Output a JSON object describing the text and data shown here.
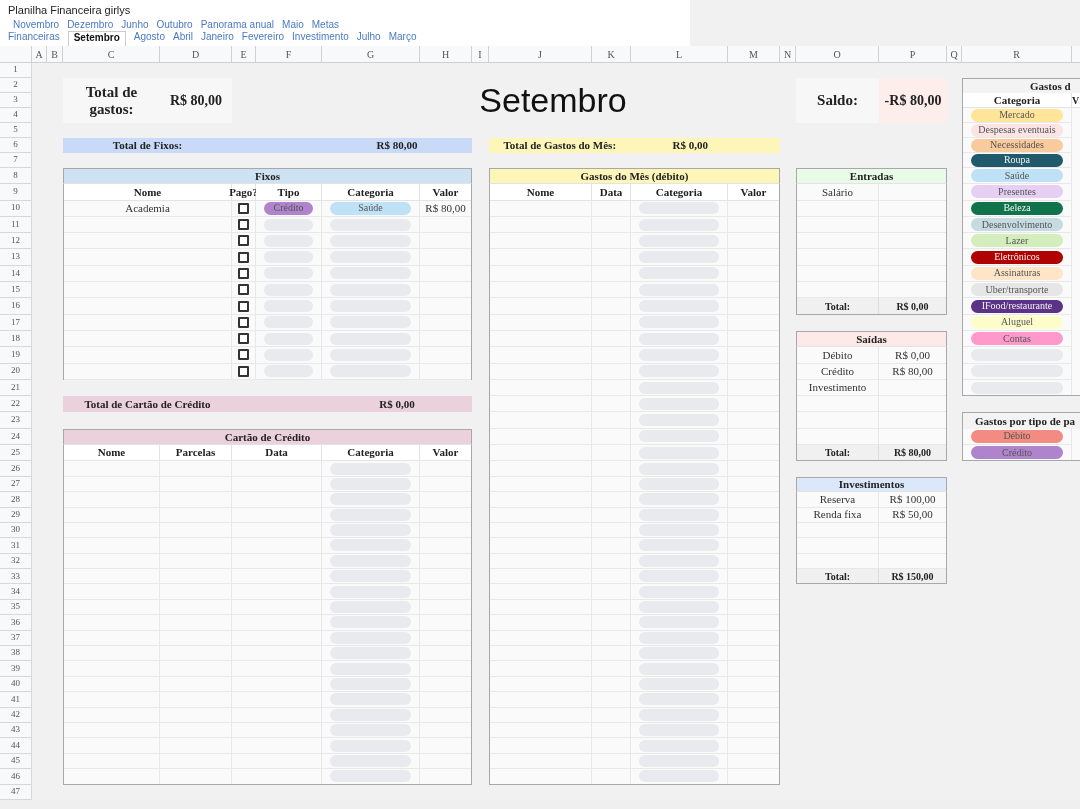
{
  "document_title": "Planilha Financeira girlys",
  "sheet_tabs": [
    [
      {
        "label": "Novembro",
        "selected": false
      },
      {
        "label": "Dezembro",
        "selected": false
      },
      {
        "label": "Junho",
        "selected": false
      },
      {
        "label": "Outubro",
        "selected": false
      },
      {
        "label": "Panorama anual",
        "selected": false
      },
      {
        "label": "Maio",
        "selected": false
      },
      {
        "label": "Metas",
        "selected": false
      }
    ],
    [
      {
        "label": "Financeiras",
        "selected": false
      },
      {
        "label": "Setembro",
        "selected": true
      },
      {
        "label": "Agosto",
        "selected": false
      },
      {
        "label": "Abril",
        "selected": false
      },
      {
        "label": "Janeiro",
        "selected": false
      },
      {
        "label": "Fevereiro",
        "selected": false
      },
      {
        "label": "Investimento",
        "selected": false
      },
      {
        "label": "Julho",
        "selected": false
      },
      {
        "label": "Março",
        "selected": false
      }
    ]
  ],
  "column_headers": [
    "A",
    "B",
    "C",
    "D",
    "E",
    "F",
    "G",
    "H",
    "I",
    "J",
    "K",
    "L",
    "M",
    "N",
    "O",
    "P",
    "Q",
    "R"
  ],
  "row_numbers": [
    "1",
    "2",
    "3",
    "4",
    "5",
    "6",
    "7",
    "8",
    "9",
    "10",
    "11",
    "12",
    "13",
    "14",
    "15",
    "16",
    "17",
    "18",
    "19",
    "20",
    "21",
    "22",
    "23",
    "24",
    "25",
    "26",
    "27",
    "28",
    "29",
    "30",
    "31",
    "32",
    "33",
    "34",
    "35",
    "36",
    "37",
    "38",
    "39",
    "40",
    "41",
    "42",
    "43",
    "44",
    "45",
    "46",
    "47"
  ],
  "summary": {
    "total_label": "Total de gastos:",
    "total_value": "R$ 80,00",
    "month_title": "Setembro",
    "saldo_label": "Saldo:",
    "saldo_value": "-R$ 80,00"
  },
  "fixos_total": {
    "label": "Total de Fixos:",
    "value": "R$ 80,00"
  },
  "fixos": {
    "title": "Fixos",
    "columns": [
      "Nome",
      "Pago?",
      "Tipo",
      "Categoria",
      "Valor"
    ],
    "rows": [
      {
        "nome": "Academia",
        "pago": false,
        "tipo": {
          "label": "Crédito",
          "color": "#b084cc"
        },
        "categoria": {
          "label": "Saúde",
          "color": "#bfe1f6"
        },
        "valor": "R$ 80,00"
      },
      {
        "pago": false
      },
      {
        "pago": false
      },
      {
        "pago": false
      },
      {
        "pago": false
      },
      {
        "pago": false
      },
      {
        "pago": false
      },
      {
        "pago": false
      },
      {
        "pago": false
      },
      {
        "pago": false
      },
      {
        "pago": false
      }
    ]
  },
  "gastos_total": {
    "label": "Total de Gastos do Mês:",
    "value": "R$ 0,00"
  },
  "gastos_mes": {
    "title": "Gastos do Mês (débito)",
    "columns": [
      "Nome",
      "Data",
      "Categoria",
      "Valor"
    ]
  },
  "cartao_total": {
    "label": "Total de Cartão de Crédito",
    "value": "R$ 0,00"
  },
  "cartao": {
    "title": "Cartão de Crédito",
    "columns": [
      "Nome",
      "Parcelas",
      "Data",
      "Categoria",
      "Valor"
    ]
  },
  "entradas": {
    "title": "Entradas",
    "rows": [
      {
        "label": "Salário"
      }
    ],
    "total_label": "Total:",
    "total_value": "R$ 0,00"
  },
  "saidas": {
    "title": "Saídas",
    "rows": [
      {
        "label": "Débito",
        "value": "R$ 0,00"
      },
      {
        "label": "Crédito",
        "value": "R$ 80,00"
      },
      {
        "label": "Investimento"
      }
    ],
    "total_label": "Total:",
    "total_value": "R$ 80,00"
  },
  "investimentos": {
    "title": "Investimentos",
    "rows": [
      {
        "label": "Reserva",
        "value": "R$ 100,00"
      },
      {
        "label": "Renda fixa",
        "value": "R$ 50,00"
      }
    ],
    "total_label": "Total:",
    "total_value": "R$ 150,00"
  },
  "categorias": {
    "title": "Gastos d",
    "columns": [
      "Categoria",
      "V"
    ],
    "items": [
      {
        "label": "Mercado",
        "color": "#ffe599"
      },
      {
        "label": "Despesas eventuais",
        "color": "#fce4e4"
      },
      {
        "label": "Necessidades",
        "color": "#f9cb9c"
      },
      {
        "label": "Roupa",
        "color": "#215a6c"
      },
      {
        "label": "Saúde",
        "color": "#bfe1f6"
      },
      {
        "label": "Presentes",
        "color": "#e6cff2"
      },
      {
        "label": "Beleza",
        "color": "#11734b"
      },
      {
        "label": "Desenvolvimento",
        "color": "#c6dbe1"
      },
      {
        "label": "Lazer",
        "color": "#d4edbc"
      },
      {
        "label": "Eletrônicos",
        "color": "#b10202"
      },
      {
        "label": "Assinaturas",
        "color": "#ffe5c8"
      },
      {
        "label": "Uber/transporte",
        "color": "#e6e6e6"
      },
      {
        "label": "IFood/restaurante",
        "color": "#5a3286"
      },
      {
        "label": "Aluguel",
        "color": "#fdfdcc"
      },
      {
        "label": "Contas",
        "color": "#ff99cc"
      }
    ]
  },
  "tipos_pagamento": {
    "title": "Gastos por tipo de pa",
    "items": [
      {
        "label": "Débito",
        "color": "#f28b82"
      },
      {
        "label": "Crédito",
        "color": "#b084cc"
      }
    ]
  }
}
